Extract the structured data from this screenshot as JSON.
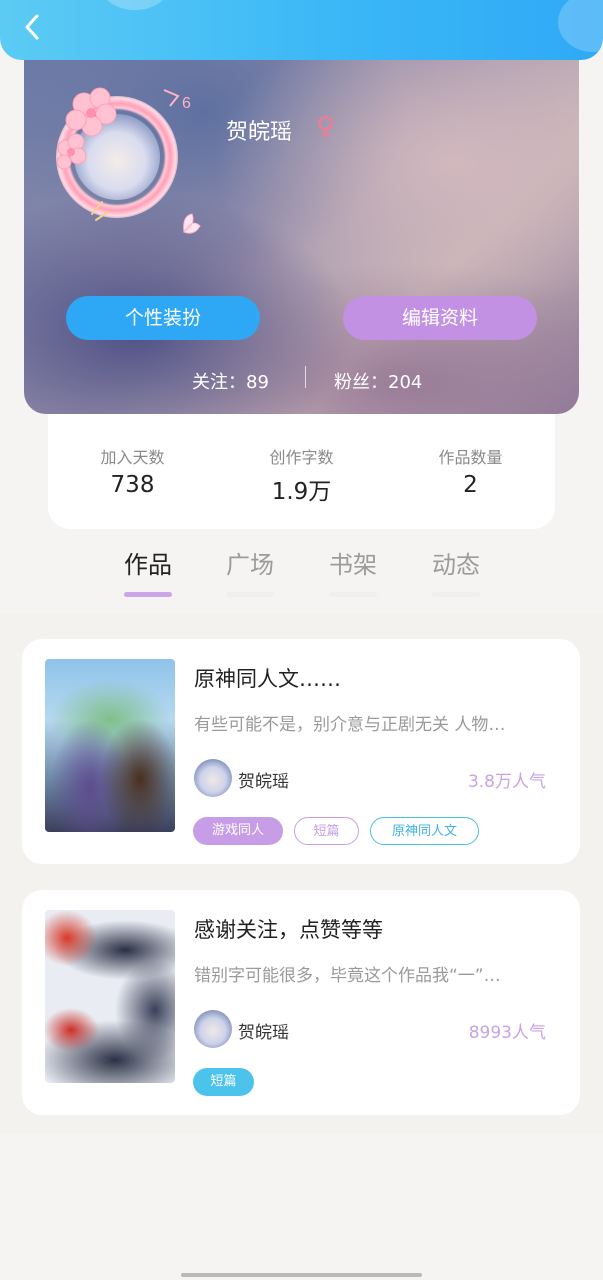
{
  "profile": {
    "name": "贺皖瑶",
    "gender_symbol": "♀",
    "level": "6",
    "dress_button": "个性装扮",
    "edit_button": "编辑资料",
    "following": "关注：89",
    "followers": "粉丝：204"
  },
  "stats": [
    {
      "label": "加入天数",
      "value": "738"
    },
    {
      "label": "创作字数",
      "value": "1.9万"
    },
    {
      "label": "作品数量",
      "value": "2"
    }
  ],
  "tabs": [
    {
      "label": "作品",
      "active": true
    },
    {
      "label": "广场",
      "active": false
    },
    {
      "label": "书架",
      "active": false
    },
    {
      "label": "动态",
      "active": false
    }
  ],
  "works": [
    {
      "title": "原神同人文……",
      "desc": "有些可能不是，别介意与正剧无关 人物…",
      "author": "贺皖瑶",
      "popularity": "3.8万人气",
      "tags": [
        "游戏同人",
        "短篇",
        "原神同人文"
      ]
    },
    {
      "title": "感谢关注，点赞等等",
      "desc": "错别字可能很多，毕竟这个作品我“一”…",
      "author": "贺皖瑶",
      "popularity": "8993人气",
      "tags": [
        "短篇"
      ]
    }
  ],
  "colors": {
    "top_bar": "#39b6f7",
    "dress_button": "#2ea8f5",
    "edit_button": "#c291e3",
    "accent_purple": "#c79de8",
    "accent_blue": "#4bbde9"
  }
}
